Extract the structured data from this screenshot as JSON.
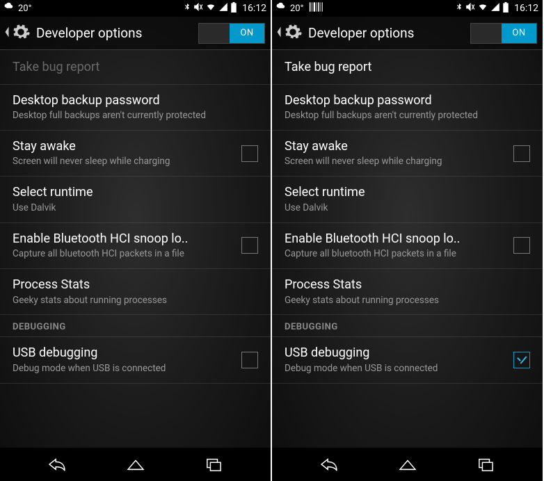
{
  "status": {
    "temperature": "20°",
    "time": "16:12"
  },
  "actionbar": {
    "title": "Developer options",
    "toggle_label": "ON"
  },
  "sections": {
    "debugging_header": "DEBUGGING"
  },
  "items": {
    "bug_report": {
      "title": "Take bug report"
    },
    "backup_pw": {
      "title": "Desktop backup password",
      "sub": "Desktop full backups aren't currently protected"
    },
    "stay_awake": {
      "title": "Stay awake",
      "sub": "Screen will never sleep while charging"
    },
    "runtime": {
      "title": "Select runtime",
      "sub": "Use Dalvik"
    },
    "bt_snoop": {
      "title": "Enable Bluetooth HCI snoop lo..",
      "sub": "Capture all bluetooth HCI packets in a file"
    },
    "process_stats": {
      "title": "Process Stats",
      "sub": "Geeky stats about running processes"
    },
    "usb_debug": {
      "title": "USB debugging",
      "sub": "Debug mode when USB is connected"
    }
  },
  "screens": {
    "left": {
      "bug_report_disabled": true,
      "usb_debug_checked": false,
      "show_barcode": false
    },
    "right": {
      "bug_report_disabled": false,
      "usb_debug_checked": true,
      "show_barcode": true
    }
  }
}
